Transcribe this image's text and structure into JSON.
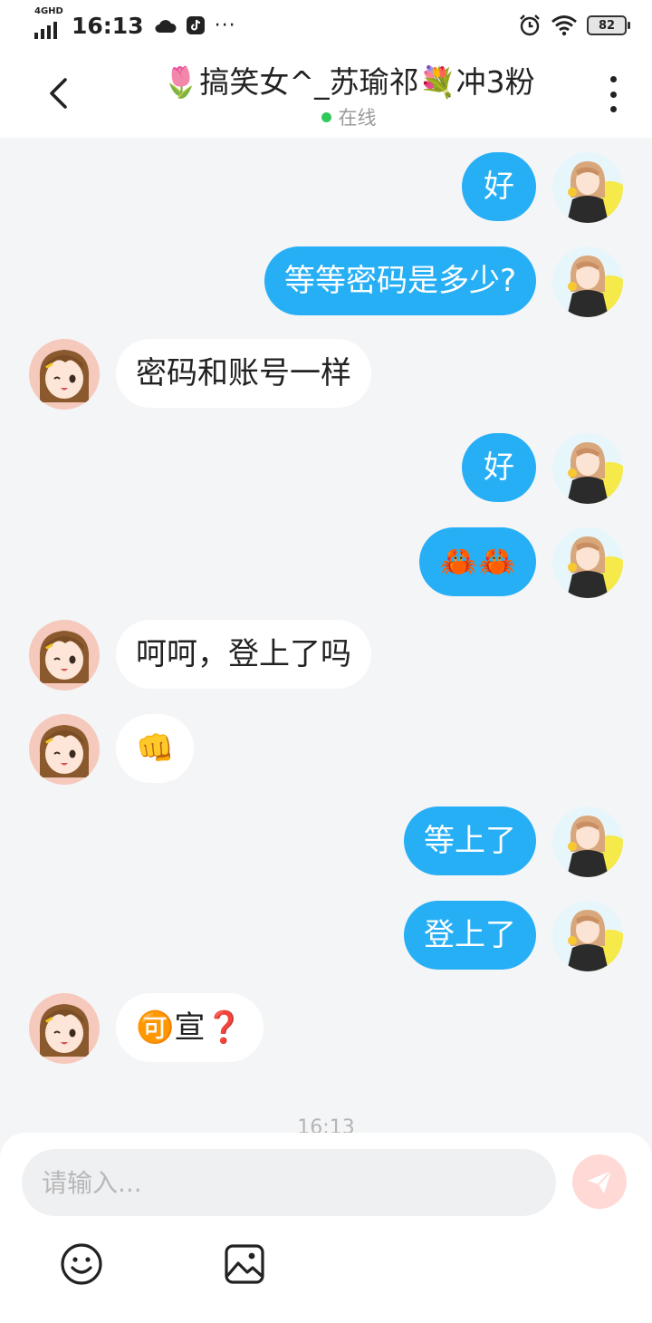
{
  "status_bar": {
    "network": "4GHD",
    "time": "16:13",
    "battery": "82"
  },
  "header": {
    "title": "🌷搞笑女^_苏瑜祁💐冲3粉",
    "status": "在线"
  },
  "messages": [
    {
      "side": "me",
      "text": "好"
    },
    {
      "side": "me",
      "text": "等等密码是多少?"
    },
    {
      "side": "other",
      "text": "密码和账号一样"
    },
    {
      "side": "me",
      "text": "好"
    },
    {
      "side": "me",
      "text": "🦀🦀"
    },
    {
      "side": "other",
      "text": "呵呵，登上了吗"
    },
    {
      "side": "other",
      "text": "👊"
    },
    {
      "side": "me",
      "text": "等上了"
    },
    {
      "side": "me",
      "text": "登上了"
    },
    {
      "side": "other",
      "text": "🉑宣❓"
    }
  ],
  "time_separator": "16:13",
  "composer": {
    "placeholder": "请输入..."
  },
  "colors": {
    "my_bubble": "#27aff5",
    "their_bubble": "#ffffff",
    "online_dot": "#2fc85b",
    "send_button": "#ffd9d6"
  },
  "icons": [
    "back-arrow-icon",
    "more-vertical-icon",
    "send-icon",
    "emoji-icon",
    "image-icon",
    "alarm-icon",
    "wifi-icon",
    "cloud-icon",
    "tiktok-icon"
  ]
}
